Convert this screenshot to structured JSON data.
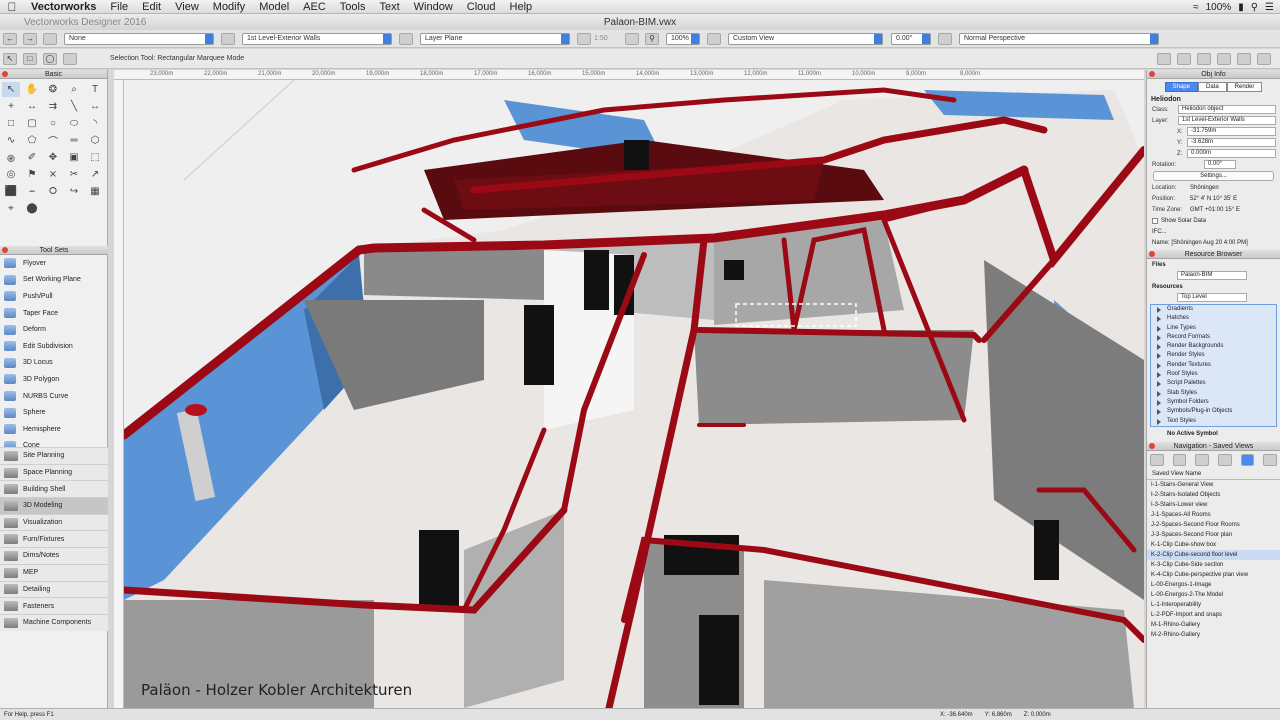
{
  "menubar": {
    "app": "Vectorworks",
    "items": [
      "File",
      "Edit",
      "View",
      "Modify",
      "Model",
      "AEC",
      "Tools",
      "Text",
      "Window",
      "Cloud",
      "Help"
    ],
    "battery": "100%"
  },
  "title": {
    "app_version": "Vectorworks Designer 2016",
    "document": "Palaon-BIM.vwx"
  },
  "toolbar": {
    "class_value": "None",
    "layer_value": "1st Level-Exterior Walls",
    "plane_value": "Layer Plane",
    "scale_value": "1:50",
    "zoom_value": "100%",
    "view_value": "Custom View",
    "angle_value": "0.00°",
    "projection_value": "Normal Perspective"
  },
  "mode_bar": {
    "text": "Selection Tool: Rectangular Marquee Mode"
  },
  "ruler": [
    "23,000m",
    "22,000m",
    "21,000m",
    "20,000m",
    "19,000m",
    "18,000m",
    "17,000m",
    "16,000m",
    "15,000m",
    "14,000m",
    "13,000m",
    "12,000m",
    "11,000m",
    "10,000m",
    "9,000m",
    "8,000m"
  ],
  "basic_palette": {
    "title": "Basic",
    "icons": [
      "arrow-icon",
      "hand-icon",
      "flyover-icon",
      "zoom-icon",
      "text-icon",
      "loci-icon",
      "mirror-icon",
      "offset-icon",
      "line-icon",
      "dim-icon",
      "rect-icon",
      "rounded-rect-icon",
      "circle-icon",
      "oval-icon",
      "arc-icon",
      "freehand-icon",
      "polygon-icon",
      "polyline-icon",
      "double-line-icon",
      "shape-icon",
      "spiral-icon",
      "eyedropper-icon",
      "pan-icon",
      "attribute-icon",
      "extract-icon",
      "target-icon",
      "stake-icon",
      "section-icon",
      "cut-icon",
      "measure-icon",
      "3d-icon",
      "curve-icon",
      "reshape-icon",
      "path-icon",
      "component-icon",
      "snap-icon",
      "symbol-icon"
    ]
  },
  "tool_sets_title": "Tool Sets",
  "tool_sets": [
    "Flyover",
    "Set Working Plane",
    "Push/Pull",
    "Taper Face",
    "Deform",
    "Edit Subdivision",
    "3D Locus",
    "3D Polygon",
    "NURBS Curve",
    "Sphere",
    "Hemisphere",
    "Cone"
  ],
  "sets": [
    "Site Planning",
    "Space Planning",
    "Building Shell",
    "3D Modeling",
    "Visualization",
    "Furn/Fixtures",
    "Dims/Notes",
    "MEP",
    "Detailing",
    "Fasteners",
    "Machine Components"
  ],
  "status": {
    "help": "For Help, press F1",
    "x": "X: -36.640m",
    "y": "Y: 6.860m",
    "z": "Z: 0.000m"
  },
  "obj_info": {
    "title": "Obj Info",
    "tabs": [
      "Shape",
      "Data",
      "Render"
    ],
    "object": "Heliodon",
    "class_label": "Class:",
    "class_value": "Heliodon object",
    "layer_label": "Layer:",
    "layer_value": "1st Level-Exterior Walls",
    "x_label": "X:",
    "x_value": "-31.759m",
    "y_label": "Y:",
    "y_value": "-3.628m",
    "z_label": "Z:",
    "z_value": "0.000m",
    "rotation_label": "Rotation:",
    "rotation_value": "0.00°",
    "settings": "Settings...",
    "location_label": "Location:",
    "location_value": "Shöningen",
    "position_label": "Position:",
    "position_value": "52° 4' N 10° 35' E",
    "tz_label": "Time Zone:",
    "tz_value": "GMT +01:00 15° E",
    "show_solar": "Show Solar Data",
    "ifc": "IFC...",
    "name": "Name: [Shöningen Aug 20 4:00 PM]"
  },
  "resource_browser": {
    "title": "Resource Browser",
    "files_label": "Files",
    "file_value": "Palaon-BIM",
    "resources_label": "Resources",
    "res_value": "Top Level",
    "items": [
      "Gradients",
      "Hatches",
      "Line Types",
      "Record Formats",
      "Render Backgrounds",
      "Render Styles",
      "Render Textures",
      "Roof Styles",
      "Script Palettes",
      "Slab Styles",
      "Symbol Folders",
      "Symbols/Plug-in Objects",
      "Text Styles"
    ],
    "no_symbol": "No Active Symbol"
  },
  "saved_views": {
    "title": "Navigation - Saved Views",
    "column": "Saved View Name",
    "items": [
      "I-1-Stairs-General View",
      "I-2-Stairs-Isolated Objects",
      "I-3-Stairs-Lower view",
      "J-1-Spaces-All Rooms",
      "J-2-Spaces-Second Floor Rooms",
      "J-3-Spaces-Second Floor plan",
      "K-1-Clip Cube-show box",
      "K-2-Clip Cube-second floor level",
      "K-3-Clip Cube-Side section",
      "K-4-Clip Cube-perspective plan view",
      "L-00-Energos-1-Image",
      "L-00-Energos-2-The Model",
      "L-1-Interoperability",
      "L-2-PDF-Import and snaps",
      "M-1-Rhino-Gallery",
      "M-2-Rhino-Gallery"
    ],
    "highlight": 7
  },
  "caption": "Paläon - Holzer Kobler Architekturen",
  "colors": {
    "wall_red": "#9b0a14",
    "glass": "#5a94d6",
    "floor": "#ece9e6",
    "accent": "#4a8af0"
  }
}
